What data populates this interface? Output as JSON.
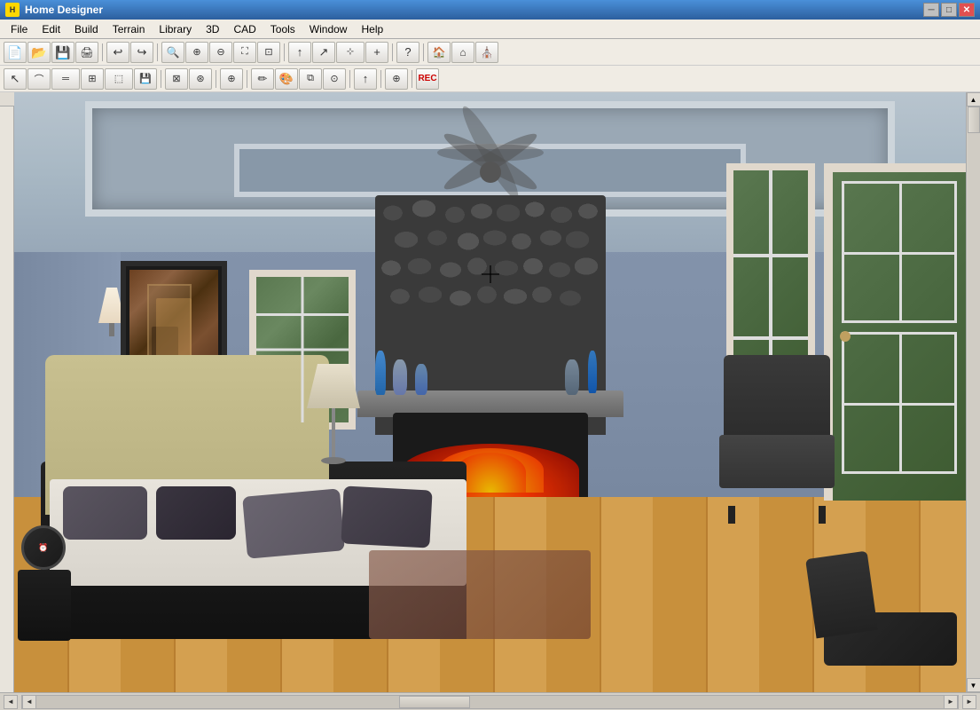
{
  "titleBar": {
    "appName": "Home Designer",
    "icon": "H",
    "minimizeLabel": "─",
    "maximizeLabel": "□",
    "closeLabel": "✕"
  },
  "menuBar": {
    "items": [
      "File",
      "Edit",
      "Build",
      "Terrain",
      "Library",
      "3D",
      "CAD",
      "Tools",
      "Window",
      "Help"
    ]
  },
  "toolbar1": {
    "buttons": [
      {
        "icon": "📄",
        "label": "New"
      },
      {
        "icon": "📂",
        "label": "Open"
      },
      {
        "icon": "💾",
        "label": "Save"
      },
      {
        "icon": "🖨",
        "label": "Print"
      },
      {
        "icon": "↩",
        "label": "Undo"
      },
      {
        "icon": "↪",
        "label": "Redo"
      },
      {
        "icon": "🔍",
        "label": "Zoom"
      },
      {
        "icon": "🔎",
        "label": "Zoom In"
      },
      {
        "icon": "🔍",
        "label": "Zoom Out"
      },
      {
        "icon": "⛶",
        "label": "Fit"
      },
      {
        "icon": "⊡",
        "label": "Select"
      },
      {
        "icon": "↗",
        "label": "Arrow"
      },
      {
        "icon": "📐",
        "label": "Measure"
      },
      {
        "icon": "⊕",
        "label": "Add"
      },
      {
        "icon": "▲",
        "label": "Up"
      },
      {
        "icon": "?",
        "label": "Help"
      },
      {
        "icon": "🏠",
        "label": "House"
      },
      {
        "icon": "⌂",
        "label": "Home2"
      },
      {
        "icon": "⛪",
        "label": "Building"
      }
    ]
  },
  "toolbar2": {
    "buttons": [
      {
        "icon": "↖",
        "label": "Select"
      },
      {
        "icon": "⌒",
        "label": "Draw"
      },
      {
        "icon": "═",
        "label": "Wall"
      },
      {
        "icon": "⊞",
        "label": "Room"
      },
      {
        "icon": "⊡",
        "label": "Object"
      },
      {
        "icon": "💾",
        "label": "Save2"
      },
      {
        "icon": "⊠",
        "label": "Delete"
      },
      {
        "icon": "⊛",
        "label": "Grid"
      },
      {
        "icon": "⊕",
        "label": "Place"
      },
      {
        "icon": "✏",
        "label": "Draw2"
      },
      {
        "icon": "🎨",
        "label": "Paint"
      },
      {
        "icon": "🔧",
        "label": "Fix"
      },
      {
        "icon": "↑",
        "label": "Move"
      },
      {
        "icon": "⊕",
        "label": "Rotate"
      },
      {
        "icon": "⊙",
        "label": "Rec"
      }
    ]
  },
  "statusBar": {
    "scrollLeftLabel": "◄",
    "scrollRightLabel": "►",
    "scrollUpLabel": "▲",
    "scrollDownLabel": "▼"
  }
}
